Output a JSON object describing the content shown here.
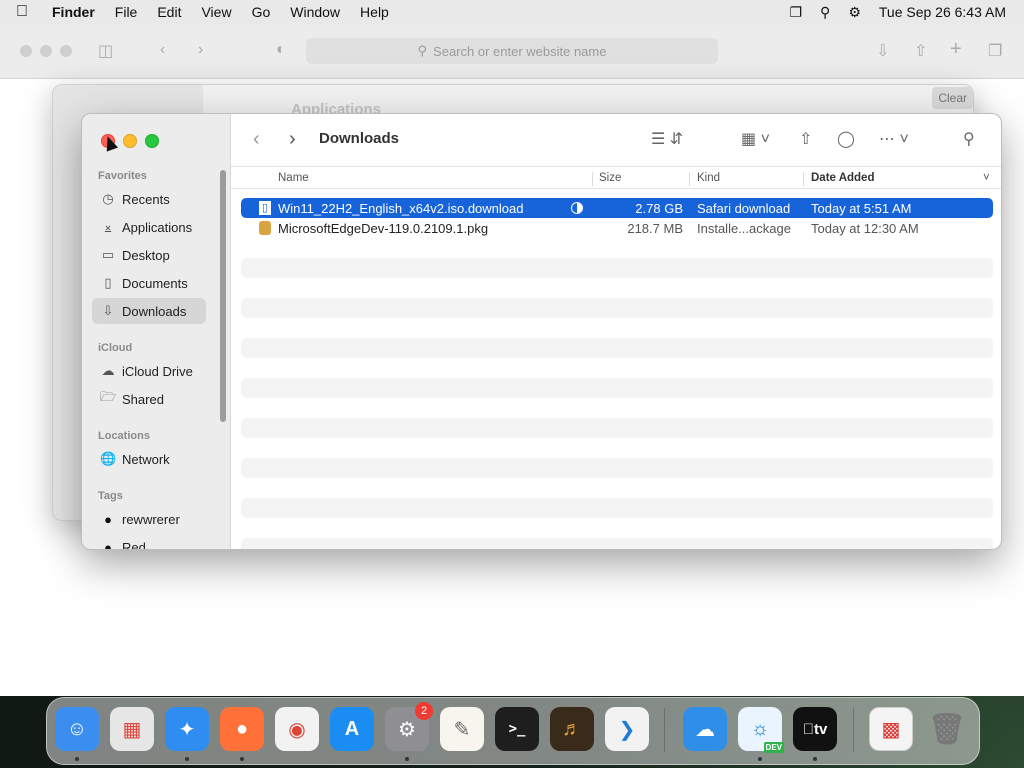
{
  "menubar": {
    "app": "Finder",
    "items": [
      "File",
      "Edit",
      "View",
      "Go",
      "Window",
      "Help"
    ],
    "clock": "Tue Sep 26  6:43 AM"
  },
  "safari": {
    "address_placeholder": "Search or enter website name"
  },
  "back_window": {
    "title": "Applications",
    "clear_label": "Clear"
  },
  "finder": {
    "title": "Downloads",
    "sidebar": {
      "favorites_label": "Favorites",
      "favorites": [
        {
          "label": "Recents",
          "icon": "clock-icon"
        },
        {
          "label": "Applications",
          "icon": "applications-icon"
        },
        {
          "label": "Desktop",
          "icon": "desktop-icon"
        },
        {
          "label": "Documents",
          "icon": "document-icon"
        },
        {
          "label": "Downloads",
          "icon": "download-icon",
          "selected": true
        }
      ],
      "icloud_label": "iCloud",
      "icloud": [
        {
          "label": "iCloud Drive",
          "icon": "cloud-icon"
        },
        {
          "label": "Shared",
          "icon": "shared-folder-icon"
        }
      ],
      "locations_label": "Locations",
      "locations": [
        {
          "label": "Network",
          "icon": "network-icon"
        }
      ],
      "tags_label": "Tags",
      "tags": [
        {
          "label": "rewwrerer",
          "color": "#111111"
        },
        {
          "label": "Red",
          "color": "#111111"
        }
      ]
    },
    "columns": {
      "name": "Name",
      "size": "Size",
      "kind": "Kind",
      "date": "Date Added"
    },
    "files": [
      {
        "name": "Win11_22H2_English_x64v2.iso.download",
        "size": "2.78 GB",
        "kind": "Safari download",
        "date": "Today at 5:51 AM",
        "selected": true,
        "progress": 0.5
      },
      {
        "name": "MicrosoftEdgeDev-119.0.2109.1.pkg",
        "size": "218.7 MB",
        "kind": "Installe...ackage",
        "date": "Today at 12:30 AM",
        "selected": false
      }
    ]
  },
  "dock": {
    "apps": [
      "Finder",
      "Launchpad",
      "Safari",
      "Firefox",
      "Chrome",
      "App Store",
      "System Settings",
      "TextEdit",
      "Terminal",
      "GarageBand",
      "VS Code",
      "Weather",
      "Edge Dev",
      "Apple TV"
    ],
    "settings_badge": "2",
    "tv_label": "tv",
    "edge_label": "DEV"
  },
  "colors": {
    "selection": "#1763d9",
    "close": "#fe5f57",
    "minimize": "#febc2e",
    "zoom": "#28c840"
  }
}
